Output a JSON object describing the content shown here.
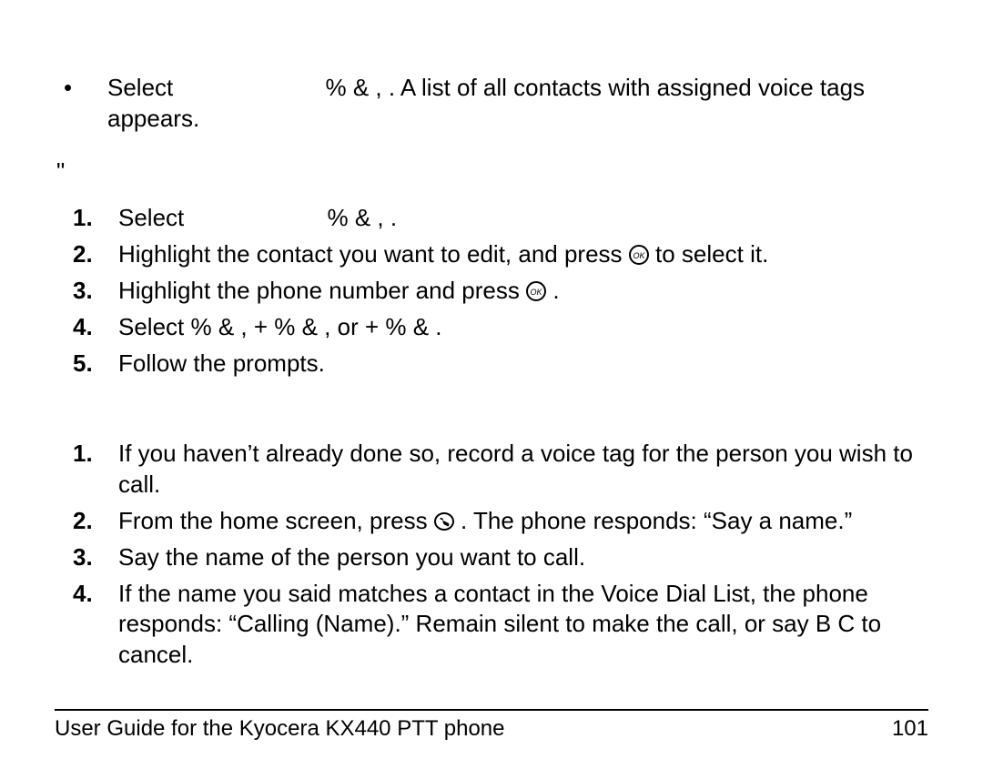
{
  "bullet": {
    "marker": "•",
    "text_a": "Select ",
    "menu_tail": "%    &    ,",
    "text_b": " . A list of all contacts with assigned voice tags appears."
  },
  "between_marker": "\"",
  "listA": [
    {
      "num": "1.",
      "pre": "Select ",
      "menu": "%    &    ,",
      "post": " ."
    },
    {
      "num": "2.",
      "pre": "Highlight the contact you want to edit, and press ",
      "post": " to select it."
    },
    {
      "num": "3.",
      "pre": "Highlight the phone number and press ",
      "post": "."
    },
    {
      "num": "4.",
      "pre": "Select ",
      "menu": "%    &    , +    %    &    , or +    %    &    .",
      "post": ""
    },
    {
      "num": "5.",
      "pre": "Follow the prompts.",
      "post": ""
    }
  ],
  "listB": [
    {
      "num": "1.",
      "pre": "If you haven’t already done so, record a voice tag for the person you wish to call.",
      "post": ""
    },
    {
      "num": "2.",
      "pre": "From the home screen, press ",
      "post": ". The phone responds: “Say a name.”"
    },
    {
      "num": "3.",
      "pre": "Say the name of the person you want to call.",
      "post": ""
    },
    {
      "num": "4.",
      "pre": "If the name you said matches a contact in the Voice Dial List, the phone responds: “Calling (Name).” Remain silent to make the call, or say B  C to cancel.",
      "post": ""
    }
  ],
  "footer": {
    "left": "User Guide for the Kyocera KX440 PTT phone",
    "right": "101"
  }
}
